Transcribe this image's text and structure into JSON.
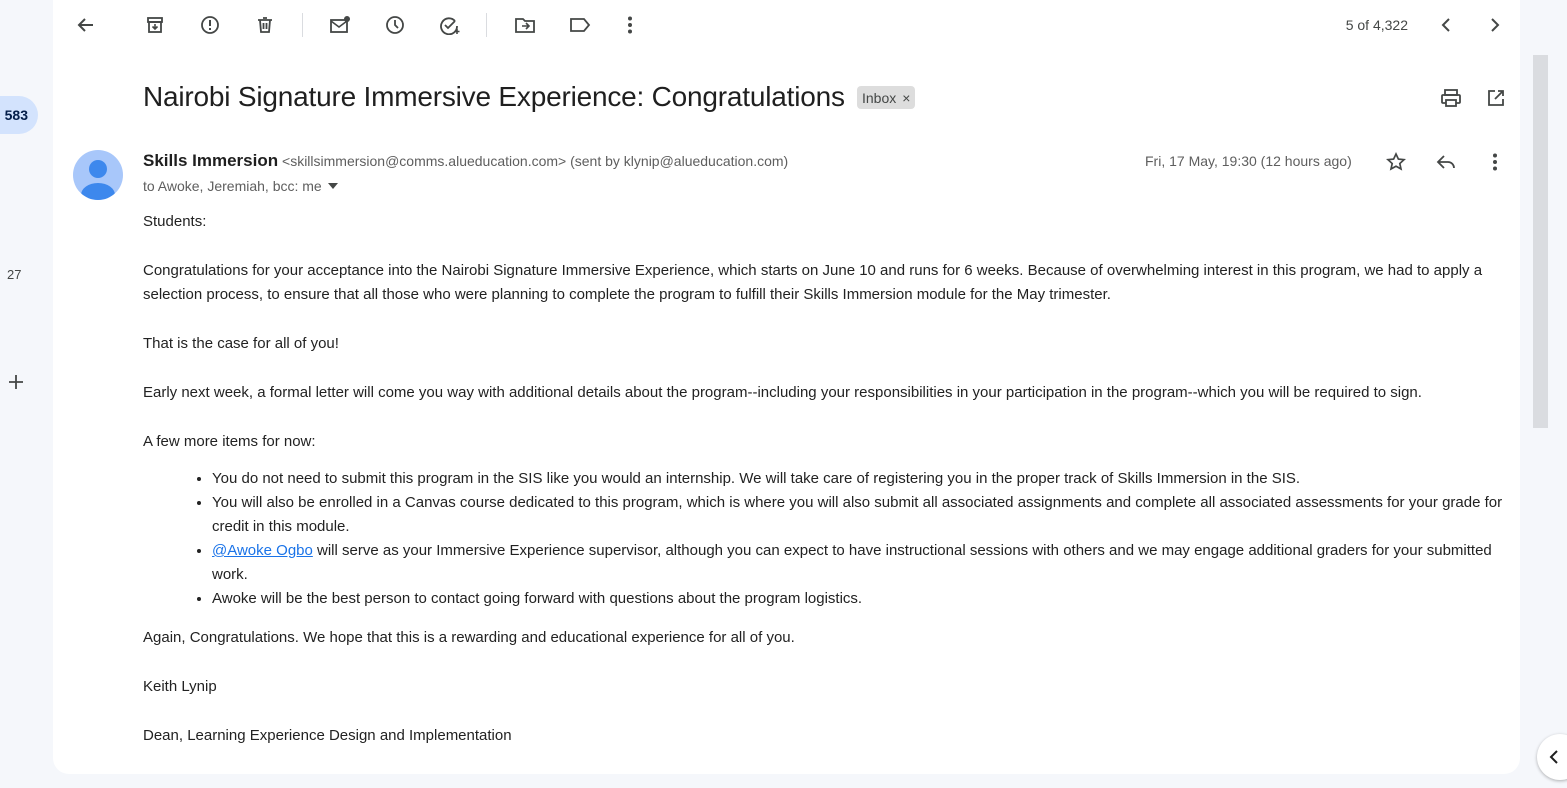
{
  "rail": {
    "badge": "583",
    "count": "27"
  },
  "toolbar": {
    "counter": "5 of 4,322"
  },
  "email": {
    "subject": "Nairobi Signature Immersive Experience: Congratulations",
    "label_chip": "Inbox",
    "label_remove": "×",
    "sender_name": "Skills Immersion",
    "sender_meta": "<skillsimmersion@comms.alueducation.com> (sent by klynip@alueducation.com)",
    "recipients": "to Awoke, Jeremiah, bcc: me",
    "date": "Fri, 17 May, 19:30 (12 hours ago)",
    "body": {
      "greeting": "Students:",
      "para1": "Congratulations for your acceptance into the Nairobi Signature Immersive Experience, which starts on June 10 and runs for 6 weeks. Because of overwhelming interest in this program, we had to apply a selection process, to ensure that all those who were planning to complete the program to fulfill their Skills Immersion module for the May trimester.",
      "para2": "That is the case for all of you!",
      "para3": "Early next week, a formal letter will come you way with additional details about the program--including your responsibilities in your participation in the program--which you will be required to sign.",
      "para4": "A few more items for now:",
      "bullet1": "You do not need to submit this program in the SIS like you would an internship. We will take care of registering you in the proper track of Skills Immersion in the SIS.",
      "bullet2": "You will also be enrolled in a Canvas course dedicated to this program, which is where you will also submit all associated assignments and complete all associated assessments for your grade for credit in this module.",
      "bullet3_mention": "@Awoke Ogbo",
      "bullet3_rest": " will serve as your Immersive Experience supervisor, although you can expect to have instructional sessions with others and we may engage additional graders for your submitted work.",
      "bullet4": "Awoke will be the best person to contact going forward with questions about the program logistics.",
      "closing": "Again, Congratulations. We hope that this is a rewarding and educational experience for all of you.",
      "signature_name": "Keith Lynip",
      "signature_title": "Dean, Learning Experience Design and Implementation"
    }
  },
  "colors": {
    "accent": "#1a73e8",
    "avatar_bg": "#a8c7fa",
    "avatar_fg": "#1a73e8"
  }
}
